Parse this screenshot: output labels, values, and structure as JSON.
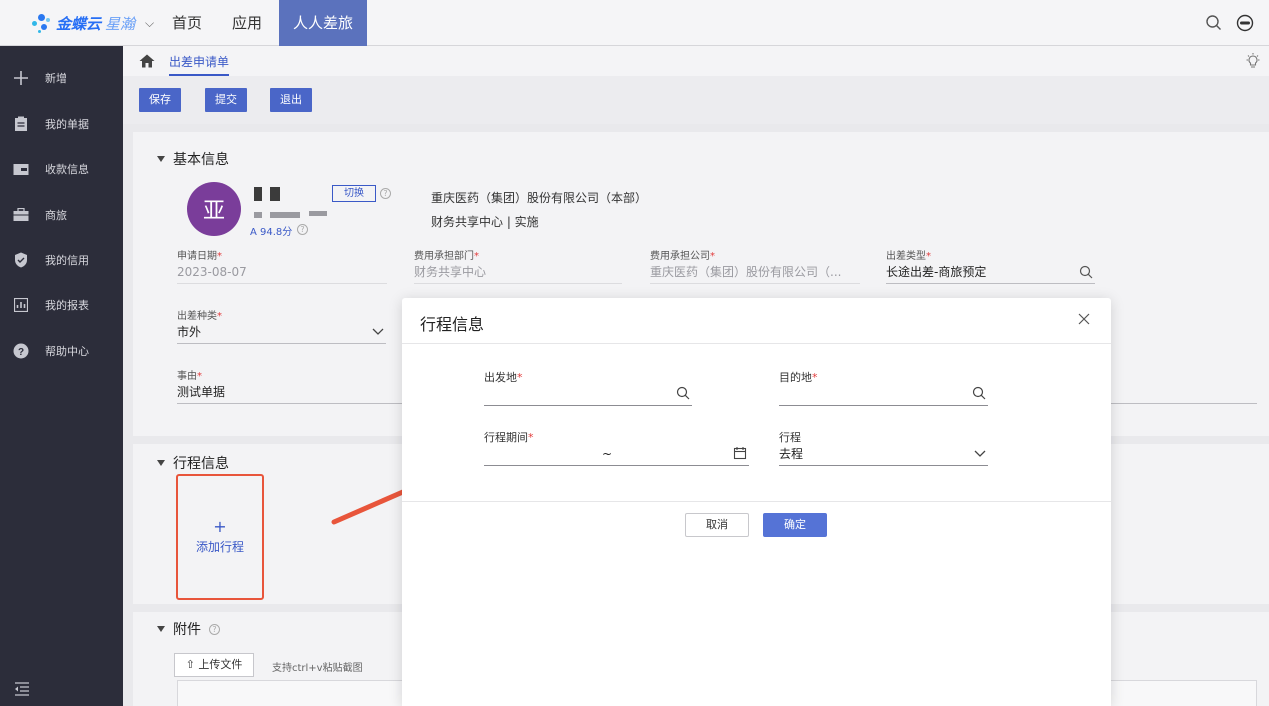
{
  "topbar": {
    "logo_text": "金蝶云",
    "logo_text2": "星瀚",
    "tabs": [
      "首页",
      "应用",
      "人人差旅"
    ]
  },
  "sidebar": {
    "items": [
      "新增",
      "我的单据",
      "收款信息",
      "商旅",
      "我的信用",
      "我的报表",
      "帮助中心"
    ]
  },
  "breadcrumb": {
    "current": "出差申请单"
  },
  "toolbar": {
    "save": "保存",
    "submit": "提交",
    "exit": "退出"
  },
  "basic": {
    "title": "基本信息",
    "avatar_char": "亚",
    "score": "A 94.8分",
    "switch": "切换",
    "company_line1": "重庆医药（集团）股份有限公司（本部）",
    "company_line2": "财务共享中心 | 实施",
    "fields": {
      "apply_date_label": "申请日期",
      "apply_date": "2023-08-07",
      "dept_label": "费用承担部门",
      "dept": "财务共享中心",
      "company_label": "费用承担公司",
      "company": "重庆医药（集团）股份有限公司（...",
      "trip_type_label": "出差类型",
      "trip_type": "长途出差-商旅预定",
      "trip_kind_label": "出差种类",
      "trip_kind": "市外",
      "reason_label": "事由",
      "reason": "测试单据"
    }
  },
  "itinerary": {
    "title": "行程信息",
    "add_plus": "+",
    "add_label": "添加行程"
  },
  "attachment": {
    "title": "附件",
    "upload": "上传文件",
    "hint": "支持ctrl+v粘贴截图"
  },
  "modal": {
    "title": "行程信息",
    "from_label": "出发地",
    "to_label": "目的地",
    "period_label": "行程期间",
    "period_sep": "~",
    "trip_label": "行程",
    "trip_value": "去程",
    "cancel": "取消",
    "confirm": "确定"
  },
  "colors": {
    "accent": "#4a66c8",
    "highlight": "#e8553b",
    "sidebar": "#2c2d3a",
    "avatar": "#7a3d9a"
  }
}
